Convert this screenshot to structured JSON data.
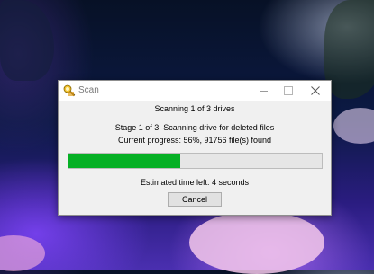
{
  "window": {
    "title": "Scan",
    "app_icon": "scan-app-icon",
    "controls": [
      "minimize",
      "maximize",
      "close"
    ]
  },
  "dialog": {
    "heading": "Scanning 1 of 3 drives",
    "stage": "Stage 1 of 3: Scanning drive for deleted files",
    "progress_text": "Current progress: 56%, 91756 file(s) found",
    "progress_percent": 44,
    "progress_color": "#06b025",
    "estimate": "Estimated time left: 4 seconds",
    "cancel_label": "Cancel"
  }
}
